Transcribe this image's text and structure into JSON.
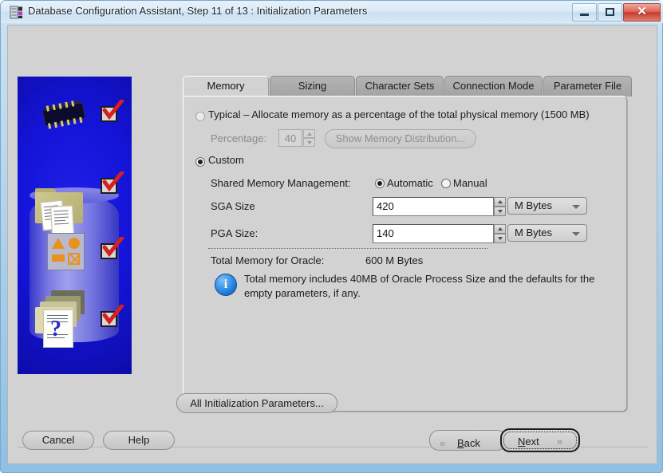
{
  "window": {
    "title": "Database Configuration Assistant, Step 11 of 13 : Initialization Parameters",
    "minimize_label": "Minimize",
    "maximize_label": "Maximize",
    "close_label": "✕"
  },
  "tabs": [
    {
      "label": "Memory",
      "active": true
    },
    {
      "label": "Sizing",
      "active": false
    },
    {
      "label": "Character Sets",
      "active": false
    },
    {
      "label": "Connection Mode",
      "active": false
    },
    {
      "label": "Parameter File",
      "active": false
    }
  ],
  "memory": {
    "typical_label": "Typical – Allocate memory as a percentage of the total physical memory (1500 MB)",
    "typical_selected": false,
    "percentage_label": "Percentage:",
    "percentage_value": "40",
    "show_memory_distribution_label": "Show Memory Distribution...",
    "custom_label": "Custom",
    "custom_selected": true,
    "shared_memory_management_label": "Shared Memory Management:",
    "automatic_label": "Automatic",
    "automatic_selected": true,
    "manual_label": "Manual",
    "manual_selected": false,
    "sga_label": "SGA Size",
    "sga_value": "420",
    "sga_unit": "M Bytes",
    "pga_label": "PGA Size:",
    "pga_value": "140",
    "pga_unit": "M Bytes",
    "total_memory_label": "Total Memory for Oracle:",
    "total_memory_value": "600 M Bytes",
    "info_text": "Total memory includes 40MB of Oracle Process Size and the defaults for the empty parameters, if any.",
    "info_icon": "info-icon"
  },
  "all_params_button": "All Initialization Parameters...",
  "footer": {
    "cancel": "Cancel",
    "help": "Help",
    "back": "Back",
    "back_prefix": "B",
    "next": "Next",
    "next_prefix": "N",
    "back_chevron": "«",
    "next_chevron": "»"
  },
  "sidebar": {
    "steps": [
      {
        "icon": "chip-icon",
        "done": true
      },
      {
        "icon": "folder-documents-icon",
        "done": true
      },
      {
        "icon": "shapes-icon",
        "done": true
      },
      {
        "icon": "folders-question-icon",
        "done": true
      }
    ]
  }
}
